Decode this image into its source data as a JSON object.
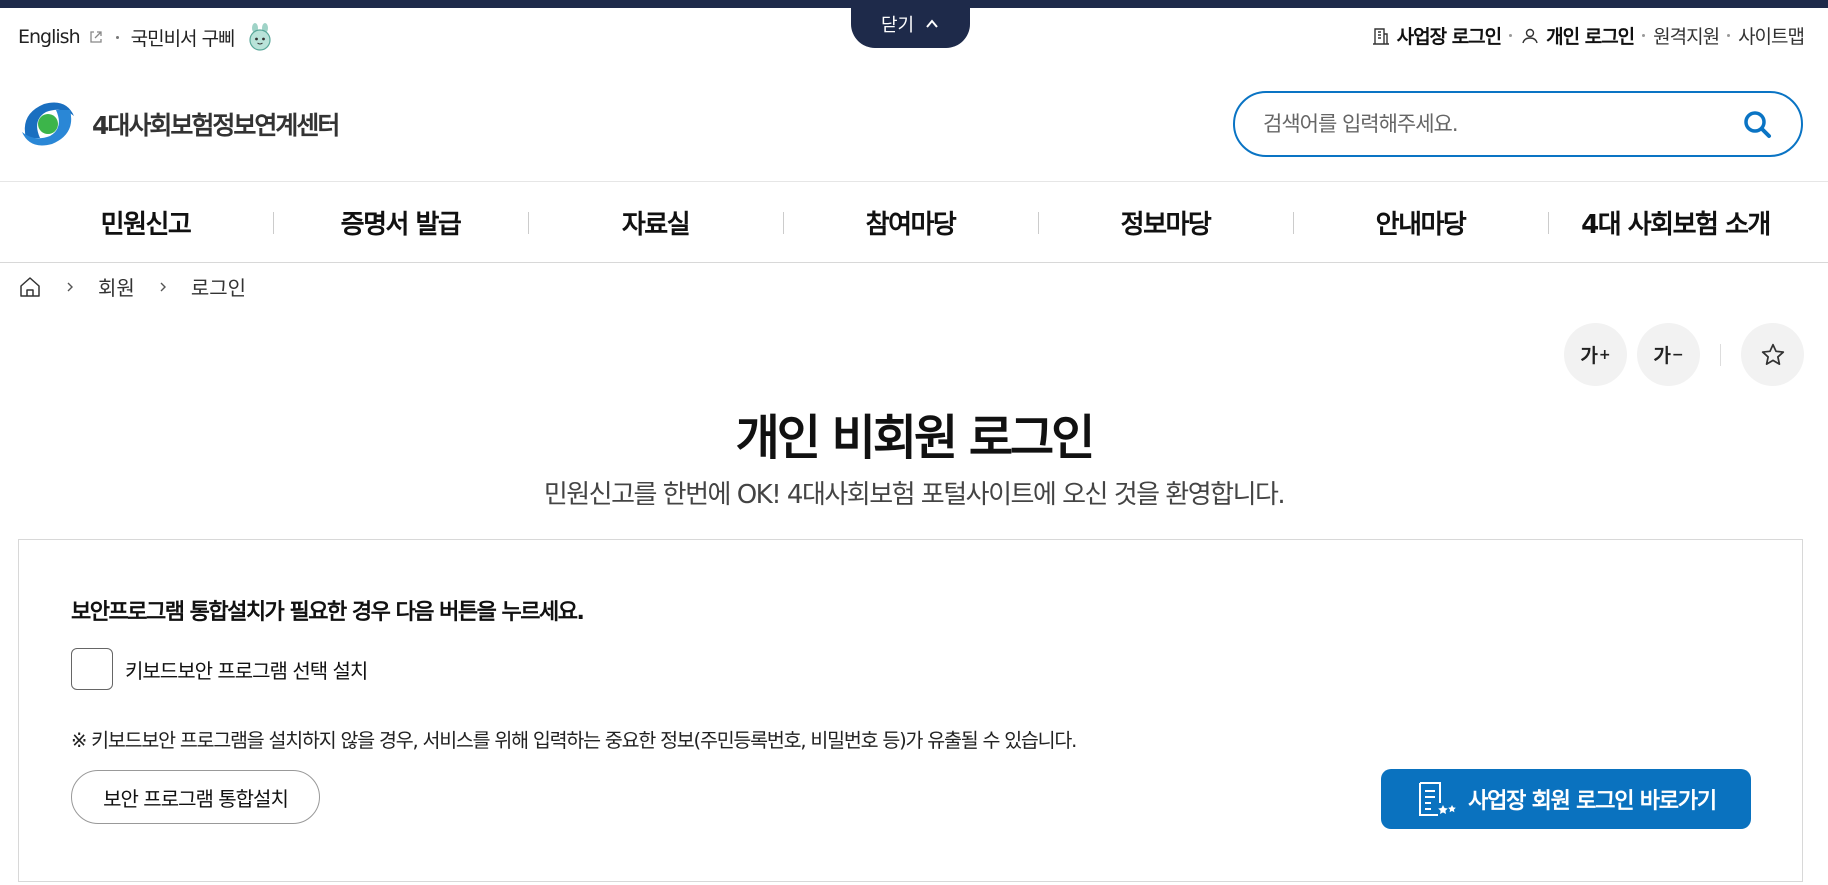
{
  "close_tab": {
    "label": "닫기"
  },
  "util_left": {
    "english": "English",
    "secretary": "국민비서 구삐"
  },
  "util_right": {
    "biz_login": "사업장 로그인",
    "personal_login": "개인 로그인",
    "remote_support": "원격지원",
    "sitemap": "사이트맵"
  },
  "logo": {
    "text": "4대사회보험정보연계센터"
  },
  "search": {
    "placeholder": "검색어를 입력해주세요."
  },
  "gnb": {
    "items": [
      {
        "label": "민원신고"
      },
      {
        "label": "증명서 발급"
      },
      {
        "label": "자료실"
      },
      {
        "label": "참여마당"
      },
      {
        "label": "정보마당"
      },
      {
        "label": "안내마당"
      },
      {
        "label": "4대 사회보험 소개"
      }
    ]
  },
  "breadcrumb": {
    "level1": "회원",
    "level2": "로그인"
  },
  "tools": {
    "font_up": "가",
    "font_down": "가"
  },
  "page": {
    "title": "개인 비회원 로그인",
    "subtitle": "민원신고를 한번에 OK! 4대사회보험 포털사이트에 오신 것을 환영합니다."
  },
  "panel": {
    "title": "보안프로그램 통합설치가 필요한 경우 다음 버튼을 누르세요.",
    "checkbox_label": "키보드보안 프로그램 선택 설치",
    "notice": "※ 키보드보안 프로그램을 설치하지 않을 경우, 서비스를 위해 입력하는 중요한 정보(주민등록번호, 비밀번호 등)가 유출될 수 있습니다.",
    "install_button": "보안 프로그램 통합설치",
    "biz_login_button": "사업장 회원 로그인 바로가기"
  },
  "colors": {
    "accent": "#0a72bf",
    "navy": "#1e2a4a"
  }
}
